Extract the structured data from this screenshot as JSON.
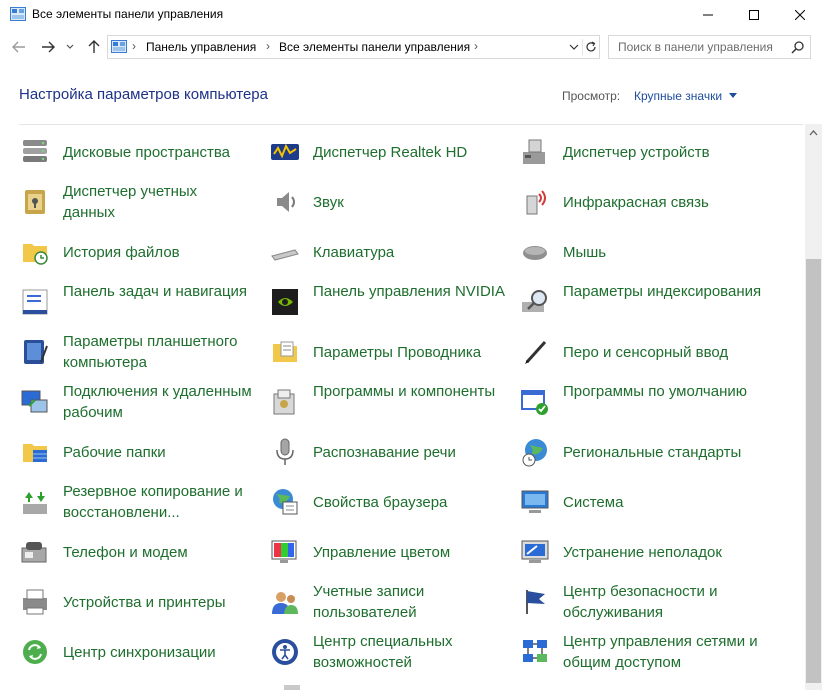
{
  "window": {
    "title": "Все элементы панели управления"
  },
  "address": {
    "crumbs": [
      "Панель управления",
      "Все элементы панели управления"
    ],
    "search_placeholder": "Поиск в панели управления"
  },
  "header": {
    "title": "Настройка параметров компьютера",
    "view_by_label": "Просмотр:",
    "view_by_value": "Крупные значки"
  },
  "colors": {
    "link_green": "#1e6e2e",
    "heading_blue": "#1e3287",
    "accent_blue": "#1e4e9e"
  },
  "items": [
    {
      "label": "Дисковые пространства",
      "icon": "storage-spaces-icon"
    },
    {
      "label": "Диспетчер Realtek HD",
      "icon": "realtek-hd-icon"
    },
    {
      "label": "Диспетчер устройств",
      "icon": "device-manager-icon"
    },
    {
      "label": "Диспетчер учетных данных",
      "icon": "credential-manager-icon"
    },
    {
      "label": "Звук",
      "icon": "sound-icon"
    },
    {
      "label": "Инфракрасная связь",
      "icon": "infrared-icon"
    },
    {
      "label": "История файлов",
      "icon": "file-history-icon"
    },
    {
      "label": "Клавиатура",
      "icon": "keyboard-icon"
    },
    {
      "label": "Мышь",
      "icon": "mouse-icon"
    },
    {
      "label": "Панель задач и навигация",
      "icon": "taskbar-icon"
    },
    {
      "label": "Панель управления NVIDIA",
      "icon": "nvidia-icon"
    },
    {
      "label": "Параметры индексирования",
      "icon": "indexing-icon"
    },
    {
      "label": "Параметры планшетного компьютера",
      "icon": "tablet-icon"
    },
    {
      "label": "Параметры Проводника",
      "icon": "explorer-options-icon"
    },
    {
      "label": "Перо и сенсорный ввод",
      "icon": "pen-icon"
    },
    {
      "label": "Подключения к удаленным рабочим",
      "icon": "remote-desktop-icon"
    },
    {
      "label": "Программы и компоненты",
      "icon": "programs-icon"
    },
    {
      "label": "Программы по умолчанию",
      "icon": "default-programs-icon"
    },
    {
      "label": "Рабочие папки",
      "icon": "work-folders-icon"
    },
    {
      "label": "Распознавание речи",
      "icon": "microphone-icon"
    },
    {
      "label": "Региональные стандарты",
      "icon": "region-icon"
    },
    {
      "label": "Резервное копирование и восстановлени...",
      "icon": "backup-icon"
    },
    {
      "label": "Свойства браузера",
      "icon": "internet-options-icon"
    },
    {
      "label": "Система",
      "icon": "system-icon"
    },
    {
      "label": "Телефон и модем",
      "icon": "phone-modem-icon"
    },
    {
      "label": "Управление цветом",
      "icon": "color-management-icon"
    },
    {
      "label": "Устранение неполадок",
      "icon": "troubleshooting-icon"
    },
    {
      "label": "Устройства и принтеры",
      "icon": "printers-icon"
    },
    {
      "label": "Учетные записи пользователей",
      "icon": "user-accounts-icon"
    },
    {
      "label": "Центр безопасности и обслуживания",
      "icon": "security-center-icon"
    },
    {
      "label": "Центр синхронизации",
      "icon": "sync-center-icon"
    },
    {
      "label": "Центр специальных возможностей",
      "icon": "ease-of-access-icon"
    },
    {
      "label": "Центр управления сетями и общим доступом",
      "icon": "network-center-icon"
    }
  ]
}
